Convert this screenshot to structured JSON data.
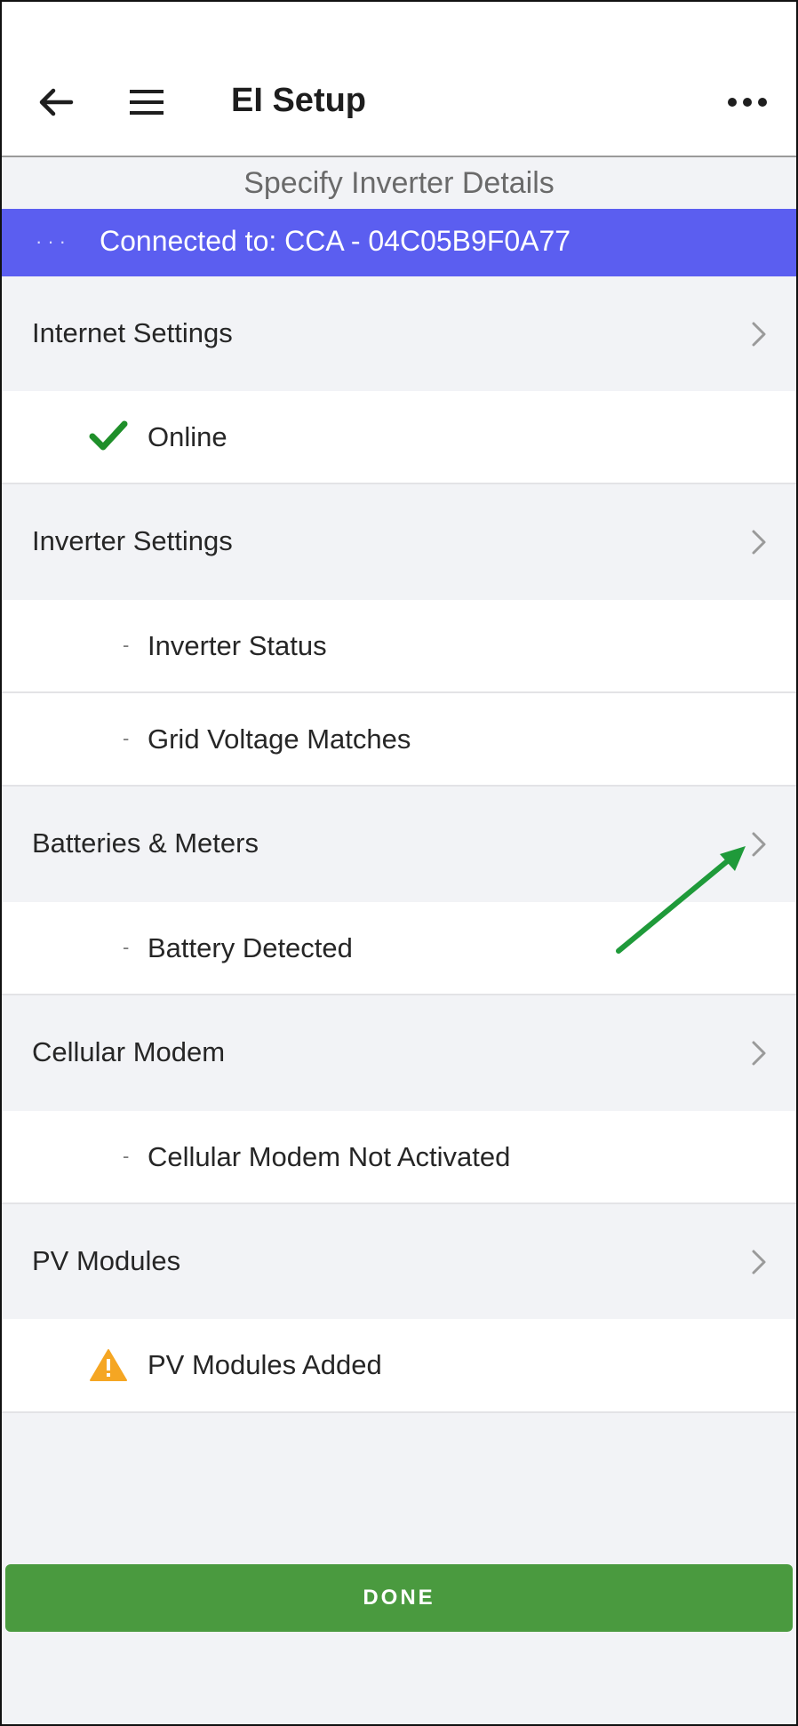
{
  "header": {
    "title": "EI Setup"
  },
  "subheader": "Specify Inverter Details",
  "connection": {
    "dots": "···",
    "text": "Connected to: CCA - 04C05B9F0A77",
    "color": "#5b5ef0"
  },
  "sections": [
    {
      "title": "Internet Settings",
      "items": [
        {
          "label": "Online",
          "icon": "check-icon"
        }
      ]
    },
    {
      "title": "Inverter Settings",
      "items": [
        {
          "label": "Inverter Status",
          "icon": "bullet"
        },
        {
          "label": "Grid Voltage Matches",
          "icon": "bullet"
        }
      ]
    },
    {
      "title": "Batteries & Meters",
      "items": [
        {
          "label": "Battery Detected",
          "icon": "bullet"
        }
      ]
    },
    {
      "title": "Cellular Modem",
      "items": [
        {
          "label": "Cellular Modem Not Activated",
          "icon": "bullet"
        }
      ]
    },
    {
      "title": "PV Modules",
      "items": [
        {
          "label": "PV Modules Added",
          "icon": "warning-icon"
        }
      ]
    }
  ],
  "bullet_char": "-",
  "footer": {
    "done_label": "DONE",
    "done_color": "#4a9a3f"
  },
  "colors": {
    "check": "#1f8f2a",
    "warning": "#f5a623",
    "annotation_arrow": "#1f9a3a"
  }
}
